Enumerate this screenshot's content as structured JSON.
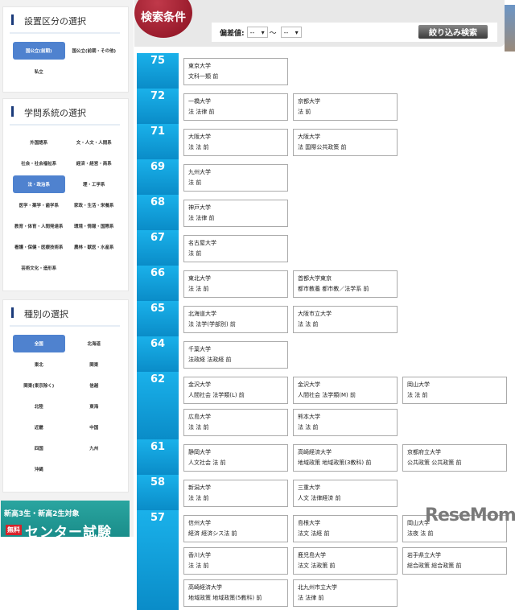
{
  "sidebar": {
    "panels": [
      {
        "title": "設置区分の選択",
        "options": [
          "国公立(前期)",
          "国公立(前期・その他)",
          "私立"
        ],
        "selected": 0
      },
      {
        "title": "学問系統の選択",
        "options": [
          "外国語系",
          "文・人文・人間系",
          "社会・社会福祉系",
          "経済・経営・商系",
          "法・政治系",
          "理・工学系",
          "医学・薬学・歯学系",
          "家政・生活・栄養系",
          "教育・体育・人間発達系",
          "環境・情報・国際系",
          "看護・保健・医療技術系",
          "農林・獣医・水産系",
          "芸術文化・造形系"
        ],
        "selected": 4
      },
      {
        "title": "種別の選択",
        "options": [
          "全国",
          "北海道",
          "東北",
          "関東",
          "関東(東京除く)",
          "信越",
          "北陸",
          "東海",
          "近畿",
          "中国",
          "四国",
          "九州",
          "沖縄"
        ],
        "selected": 0
      }
    ],
    "banner": {
      "line1": "新高3生・新高2生対象",
      "tag": "無料",
      "line2": "センター試験"
    }
  },
  "header": {
    "badge": "検索条件",
    "filter_label": "偏差値:",
    "from": "--",
    "tilde": "〜",
    "to": "--",
    "search_button": "絞り込み検索"
  },
  "rows": [
    {
      "score": "75",
      "cards": [
        [
          "東京大学",
          "文科一類 前"
        ]
      ]
    },
    {
      "score": "72",
      "cards": [
        [
          "一橋大学",
          "法 法律 前"
        ],
        [
          "京都大学",
          "法 前"
        ]
      ]
    },
    {
      "score": "71",
      "cards": [
        [
          "大阪大学",
          "法 法 前"
        ],
        [
          "大阪大学",
          "法 国際公共政策 前"
        ]
      ]
    },
    {
      "score": "69",
      "cards": [
        [
          "九州大学",
          "法 前"
        ]
      ]
    },
    {
      "score": "68",
      "cards": [
        [
          "神戸大学",
          "法 法律 前"
        ]
      ]
    },
    {
      "score": "67",
      "cards": [
        [
          "名古屋大学",
          "法 前"
        ]
      ]
    },
    {
      "score": "66",
      "cards": [
        [
          "東北大学",
          "法 法 前"
        ],
        [
          "首都大学東京",
          "都市教養 都市教／法学系 前"
        ]
      ]
    },
    {
      "score": "65",
      "cards": [
        [
          "北海道大学",
          "法 法学(学部別) 前"
        ],
        [
          "大阪市立大学",
          "法 法 前"
        ]
      ]
    },
    {
      "score": "64",
      "cards": [
        [
          "千葉大学",
          "法政経 法政経 前"
        ]
      ]
    },
    {
      "score": "62",
      "cards": [
        [
          "金沢大学",
          "人間社会 法学類(L) 前"
        ],
        [
          "金沢大学",
          "人間社会 法学類(M) 前"
        ],
        [
          "岡山大学",
          "法 法 前"
        ],
        [
          "広島大学",
          "法 法 前"
        ],
        [
          "熊本大学",
          "法 法 前"
        ]
      ]
    },
    {
      "score": "61",
      "cards": [
        [
          "静岡大学",
          "人文社会 法 前"
        ],
        [
          "高崎経済大学",
          "地域政策 地域政策(3教科) 前"
        ],
        [
          "京都府立大学",
          "公共政策 公共政策 前"
        ]
      ]
    },
    {
      "score": "58",
      "cards": [
        [
          "新潟大学",
          "法 法 前"
        ],
        [
          "三重大学",
          "人文 法律経済 前"
        ]
      ]
    },
    {
      "score": "57",
      "cards": [
        [
          "信州大学",
          "経済 経済シス法 前"
        ],
        [
          "島根大学",
          "法文 法経 前"
        ],
        [
          "岡山大学",
          "法夜 法 前"
        ],
        [
          "香川大学",
          "法 法 前"
        ],
        [
          "鹿児島大学",
          "法文 法政策 前"
        ],
        [
          "岩手県立大学",
          "総合政策 総合政策 前"
        ],
        [
          "高崎経済大学",
          "地域政策 地域政策(5教科) 前"
        ],
        [
          "北九州市立大学",
          "法 法律 前"
        ]
      ]
    }
  ],
  "logo": "ReseMom"
}
